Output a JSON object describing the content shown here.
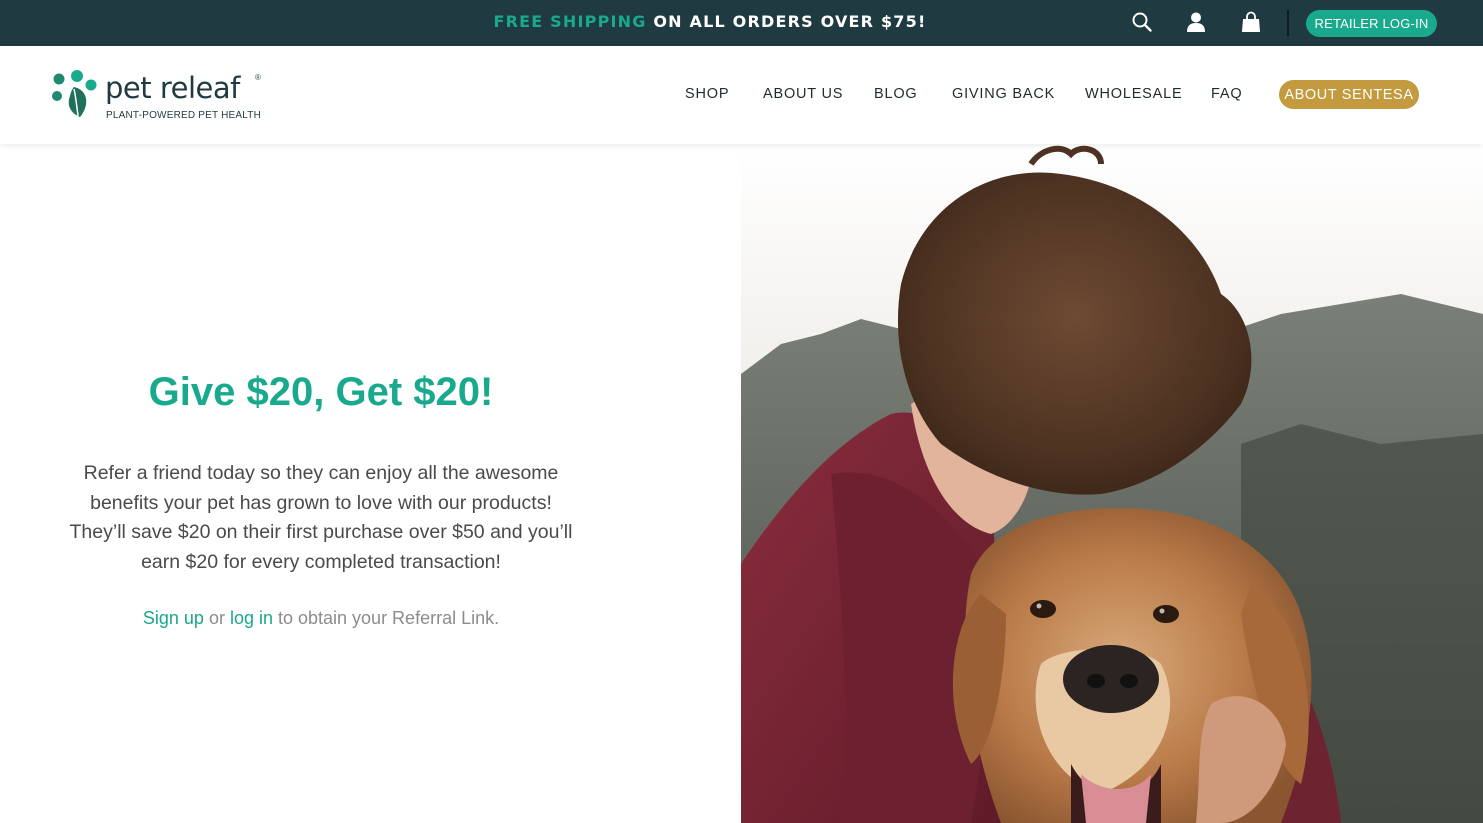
{
  "announcement": {
    "highlight": "FREE SHIPPING",
    "rest": " ON ALL ORDERS OVER $75!",
    "retailer_login": "RETAILER LOG-IN",
    "icons": [
      "search-icon",
      "account-icon",
      "cart-icon"
    ]
  },
  "brand": {
    "name": "pet releaf",
    "registered": "®",
    "tagline": "PLANT-POWERED PET HEALTH"
  },
  "nav": {
    "items": [
      {
        "label": "SHOP"
      },
      {
        "label": "ABOUT US"
      },
      {
        "label": "BLOG"
      },
      {
        "label": "GIVING BACK"
      },
      {
        "label": "WHOLESALE"
      },
      {
        "label": "FAQ"
      }
    ],
    "cta": "ABOUT SENTESA"
  },
  "referral": {
    "headline": "Give $20, Get $20!",
    "body_lines": [
      "Refer a friend today so they can enjoy all the awesome",
      "benefits your pet has grown to love with our products!",
      "They’ll save $20 on their first purchase over $50 and you’ll",
      "earn $20 for every completed transaction!"
    ],
    "signup_link": "Sign up",
    "or_text": " or ",
    "login_link": "log in",
    "suffix": " to obtain your Referral Link."
  },
  "colors": {
    "topbar": "#1f3a40",
    "accent_green": "#19a98c",
    "gold": "#c39a3e"
  }
}
